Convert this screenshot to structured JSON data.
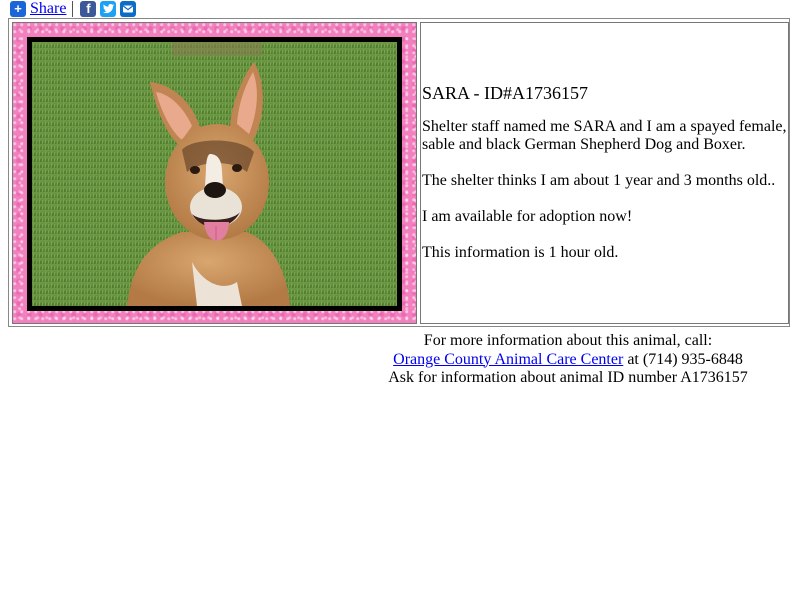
{
  "share": {
    "label": "Share",
    "icons": [
      "share-plus-icon",
      "facebook-icon",
      "twitter-icon",
      "email-icon"
    ]
  },
  "animal": {
    "title": "SARA - ID#A1736157",
    "description_1": "Shelter staff named me SARA and I am a spayed female, sable and black German Shepherd Dog and Boxer.",
    "description_2": "The shelter thinks I am about 1 year and 3 months old..",
    "description_3": "I am available for adoption now!",
    "description_4": "This information is 1 hour old.",
    "photo": "dog-photo (tan German Shepherd / Boxer mix on grass)"
  },
  "footer": {
    "line1": "For more information about this animal, call:",
    "shelter_link": "Orange County Animal Care Center",
    "phone_text": " at (714) 935-6848",
    "line3": "Ask for information about animal ID number A1736157"
  },
  "colors": {
    "link": "#0000ee",
    "frame_pink": "#f27fbe",
    "facebook": "#3b5998",
    "twitter": "#1da1f2",
    "email": "#0b6dc7",
    "share": "#1a66d9"
  }
}
